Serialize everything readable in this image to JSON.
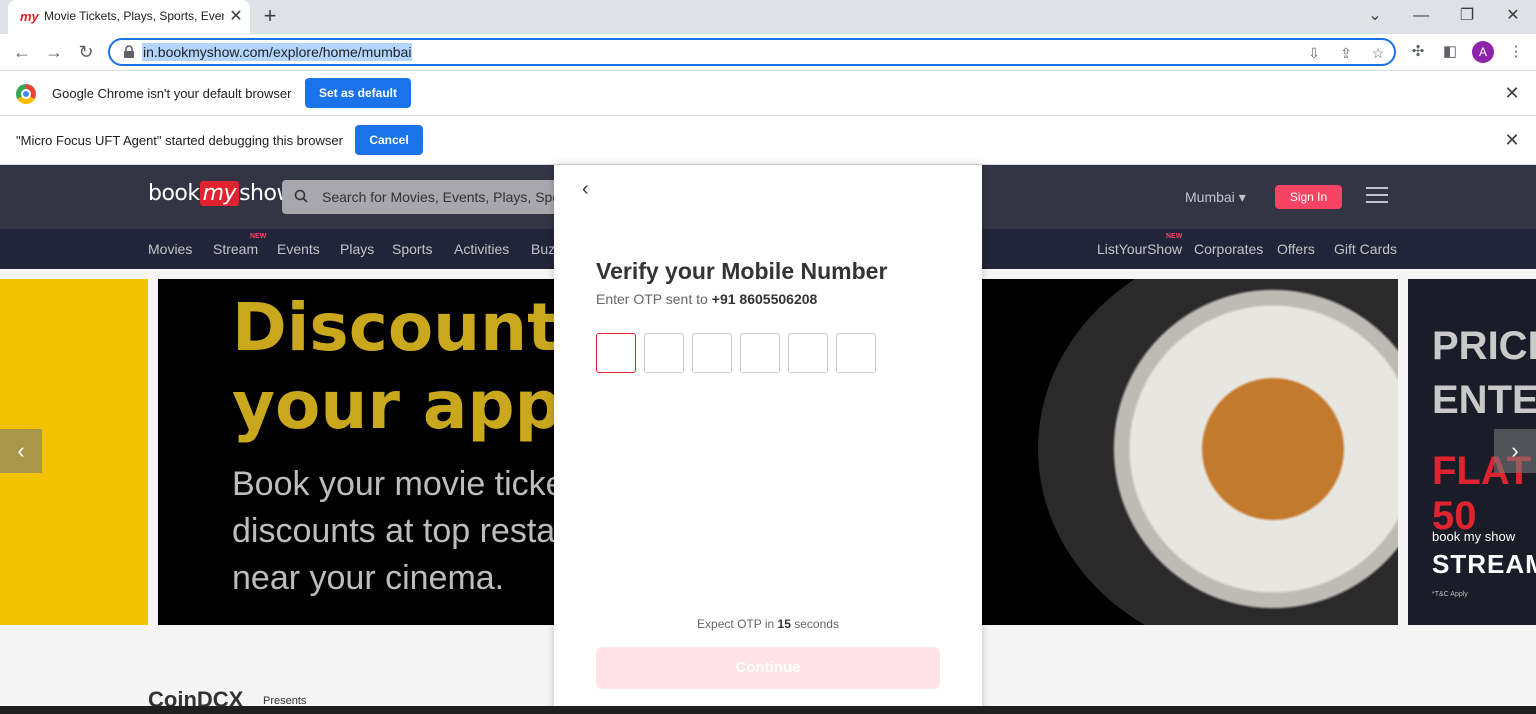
{
  "browser": {
    "tab_title": "Movie Tickets, Plays, Sports, Events & Cinemas",
    "tab_favicon": "my",
    "url": "in.bookmyshow.com/explore/home/mumbai",
    "new_tab": "+",
    "profile_initial": "A"
  },
  "infobars": {
    "default_browser_text": "Google Chrome isn't your default browser",
    "set_default_label": "Set as default",
    "debugging_text": "\"Micro Focus UFT Agent\" started debugging this browser",
    "cancel_label": "Cancel"
  },
  "site": {
    "logo_book": "book",
    "logo_my": "my",
    "logo_show": "show",
    "search_placeholder": "Search for Movies, Events, Plays, Sports and Activities",
    "city": "Mumbai",
    "sign_in": "Sign In",
    "nav_left": [
      "Movies",
      "Stream",
      "Events",
      "Plays",
      "Sports",
      "Activities",
      "Buzz"
    ],
    "nav_right": [
      "ListYourShow",
      "Corporates",
      "Offers",
      "Gift Cards"
    ],
    "new_badge": "NEW",
    "banner": {
      "headline_1": "Discounts b",
      "headline_2": "your appeti",
      "sub_1": "Book your movie ticke",
      "sub_2": "discounts at top resta",
      "sub_3": "near your cinema."
    },
    "banner_right": {
      "prices": "PRICES:",
      "entert": "ENTERT",
      "flat": "FLAT 50",
      "bms": "book my show",
      "stream": "STREAM",
      "tc": "*T&C Apply"
    },
    "coindcx": "CoinDCX",
    "presents": "Presents"
  },
  "modal": {
    "title": "Verify your Mobile Number",
    "otp_sent_prefix": "Enter OTP sent to",
    "phone": "+91 8605506208",
    "expect_prefix": "Expect OTP in",
    "expect_seconds": "15",
    "expect_suffix": "seconds",
    "continue_label": "Continue",
    "otp_digits": [
      "",
      "",
      "",
      "",
      "",
      ""
    ]
  },
  "colors": {
    "brand_red": "#e0242f",
    "chrome_blue": "#1a73e8",
    "header_bg": "#333545",
    "nav_bg": "#222539"
  }
}
